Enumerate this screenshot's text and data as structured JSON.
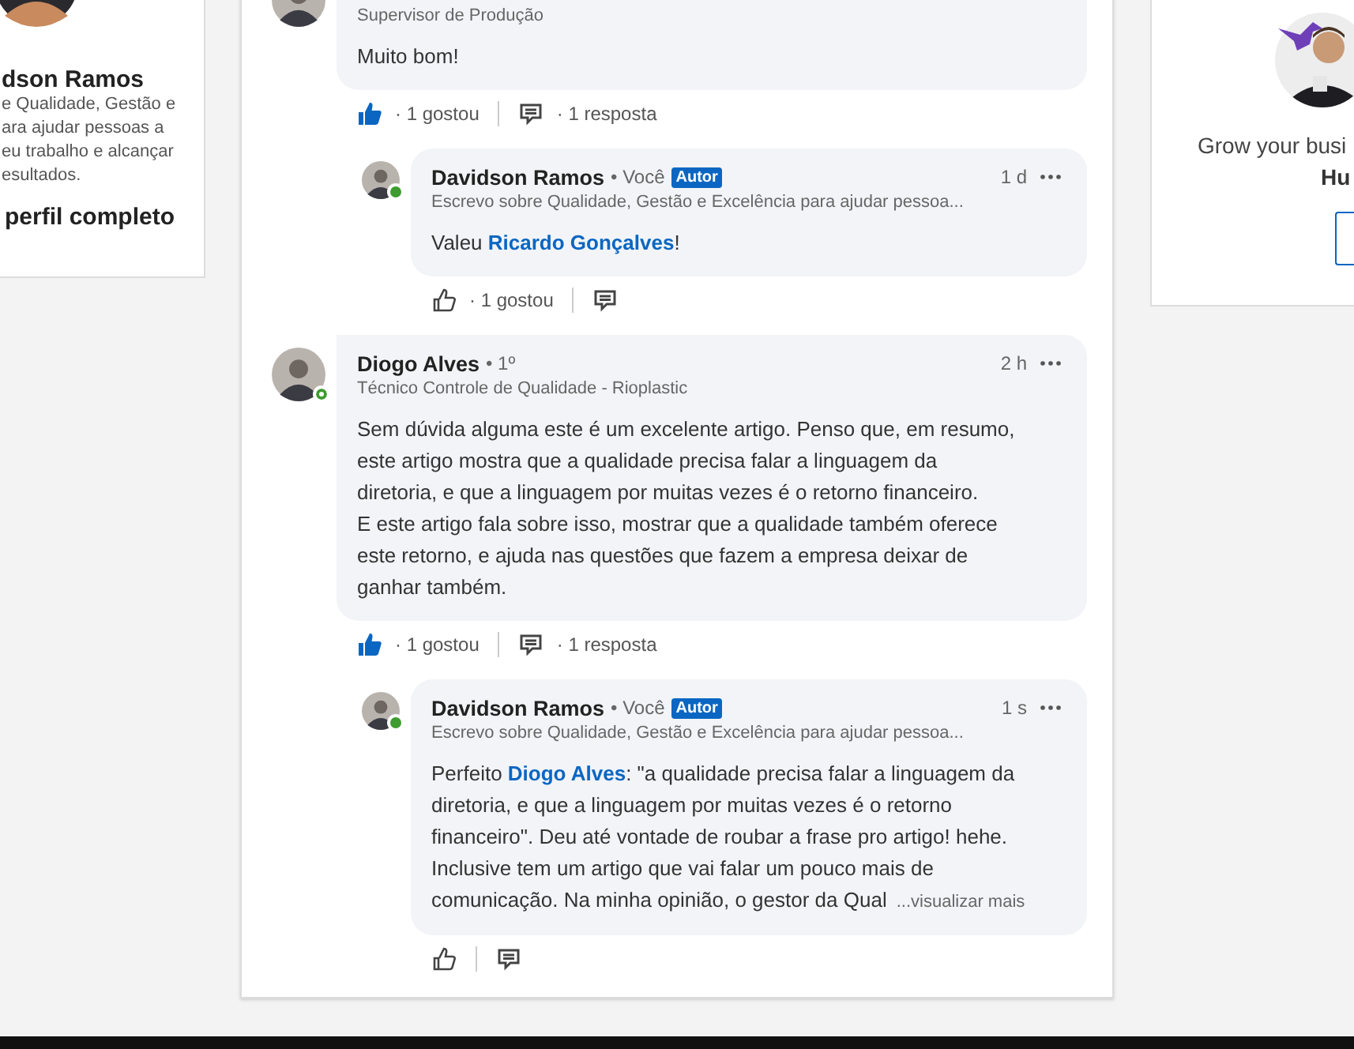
{
  "left_card": {
    "name": "dson Ramos",
    "headline_lines": [
      "e Qualidade, Gestão e",
      "ara ajudar pessoas a",
      "eu trabalho e alcançar",
      "esultados."
    ],
    "link": "perfil completo"
  },
  "comments": [
    {
      "headline": "Supervisor de Produção",
      "body": [
        {
          "kind": "text",
          "text": "Muito bom!"
        }
      ],
      "liked": true,
      "likes": "· 1 gostou",
      "replies_count": "· 1 resposta",
      "replies": [
        {
          "name": "Davidson Ramos",
          "degree": "• Você",
          "badge": "Autor",
          "headline": "Escrevo sobre Qualidade, Gestão e Excelência para ajudar pessoa...",
          "time": "1 d",
          "online": true,
          "body": [
            {
              "kind": "text",
              "text": "Valeu "
            },
            {
              "kind": "mention",
              "text": "Ricardo Gonçalves"
            },
            {
              "kind": "text",
              "text": "!"
            }
          ],
          "liked": false,
          "likes": "· 1 gostou"
        }
      ]
    },
    {
      "name": "Diogo Alves",
      "degree": "• 1º",
      "headline": "Técnico Controle de Qualidade - Rioplastic",
      "time": "2 h",
      "online": false,
      "body": [
        {
          "kind": "text",
          "text": "Sem dúvida alguma este é um excelente artigo. Penso que, em resumo,\neste artigo mostra que a qualidade precisa falar a linguagem da\ndiretoria, e que a linguagem por muitas vezes é o retorno financeiro.\nE este artigo fala sobre isso, mostrar que a qualidade também oferece\neste retorno, e ajuda nas questões que fazem a empresa deixar de\nganhar também."
        }
      ],
      "liked": true,
      "likes": "· 1 gostou",
      "replies_count": "· 1 resposta",
      "replies": [
        {
          "name": "Davidson Ramos",
          "degree": "• Você",
          "badge": "Autor",
          "headline": "Escrevo sobre Qualidade, Gestão e Excelência para ajudar pessoa...",
          "time": "1 s",
          "online": true,
          "body": [
            {
              "kind": "text",
              "text": "Perfeito "
            },
            {
              "kind": "mention",
              "text": "Diogo Alves"
            },
            {
              "kind": "text",
              "text": ": \"a qualidade precisa falar a linguagem da\ndiretoria, e que a linguagem por muitas vezes é o retorno\nfinanceiro\". Deu até vontade de roubar a frase pro artigo! hehe.\nInclusive tem um artigo que vai falar um pouco mais de\ncomunicação. Na minha opinião, o gestor da Qual"
            },
            {
              "kind": "more",
              "text": "...visualizar mais"
            }
          ],
          "liked": false
        }
      ]
    }
  ],
  "right_card": {
    "text_lines": [
      "Grow your busi",
      "Hu"
    ]
  }
}
